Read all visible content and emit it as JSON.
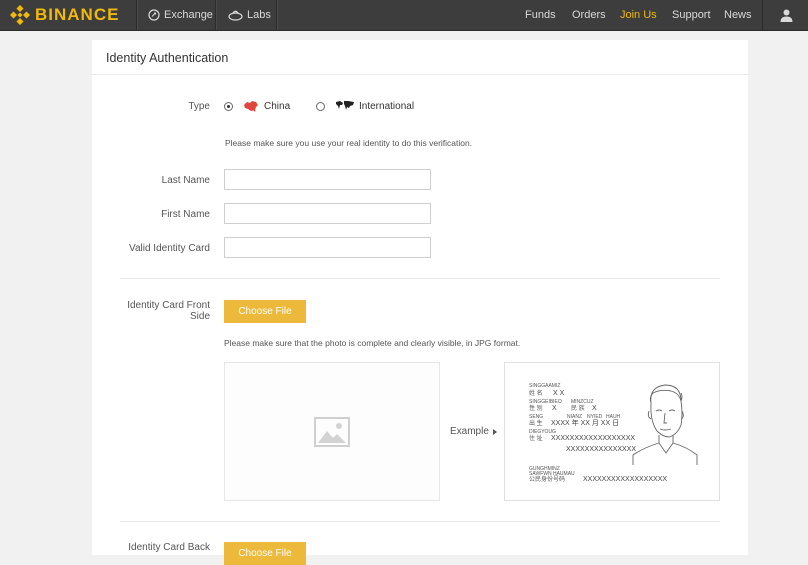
{
  "nav": {
    "brand": "BINANCE",
    "left_items": [
      {
        "label": "Exchange",
        "icon": "exchange-icon"
      },
      {
        "label": "Labs",
        "icon": "labs-icon"
      }
    ],
    "right_items": [
      {
        "label": "Funds"
      },
      {
        "label": "Orders"
      },
      {
        "label": "Join Us",
        "active": true
      },
      {
        "label": "Support"
      },
      {
        "label": "News"
      }
    ],
    "user_icon": "user-icon"
  },
  "colors": {
    "brand": "#f0b90b",
    "button": "#ecb93a",
    "nav_bg": "#3d3d3d"
  },
  "card": {
    "title": "Identity Authentication"
  },
  "form": {
    "type_label": "Type",
    "options": [
      {
        "label": "China",
        "selected": true,
        "icon": "china-map-icon"
      },
      {
        "label": "International",
        "selected": false,
        "icon": "world-map-icon"
      }
    ],
    "identity_hint": "Please make sure you use your real identity to do this verification.",
    "last_name_label": "Last Name",
    "last_name_value": "",
    "first_name_label": "First Name",
    "first_name_value": "",
    "id_card_label": "Valid Identity Card",
    "id_card_value": "",
    "front_label_line1": "Identity Card Front",
    "front_label_line2": "Side",
    "choose_file": "Choose File",
    "photo_hint": "Please make sure that the photo is complete and clearly visible, in JPG format.",
    "example_label": "Example",
    "back_label": "Identity Card Back",
    "back_choose_file": "Choose File"
  },
  "id_sample": {
    "r1_small": "SINGGAAMIZ",
    "r1_cn": "姓 名",
    "r1_val": "X X",
    "r2_small": "SINGGEIBIEO",
    "r2_small_b": "MINZCUZ",
    "r2_cn": "性 别",
    "r2_val": "X",
    "r2_cn_b": "民 族",
    "r2_val_b": "X",
    "r3_small": "SENG",
    "r3_small_b": "NIANZ",
    "r3_small_c": "NYIED",
    "r3_small_d": "HAUH",
    "r3_cn": "出 生",
    "r3_val": "XXXX 年 XX 月 XX 日",
    "r4_small": "DIEGYOUG",
    "r4_cn": "住 址",
    "r4_val1": "XXXXXXXXXXXXXXXXXX",
    "r4_val2": "XXXXXXXXXXXXXXX",
    "r5_small1": "GUNGHMINZ",
    "r5_small2": "SAWFWN HAUMAU",
    "r5_cn": "公民身份号码",
    "r5_val": "XXXXXXXXXXXXXXXXXX"
  }
}
